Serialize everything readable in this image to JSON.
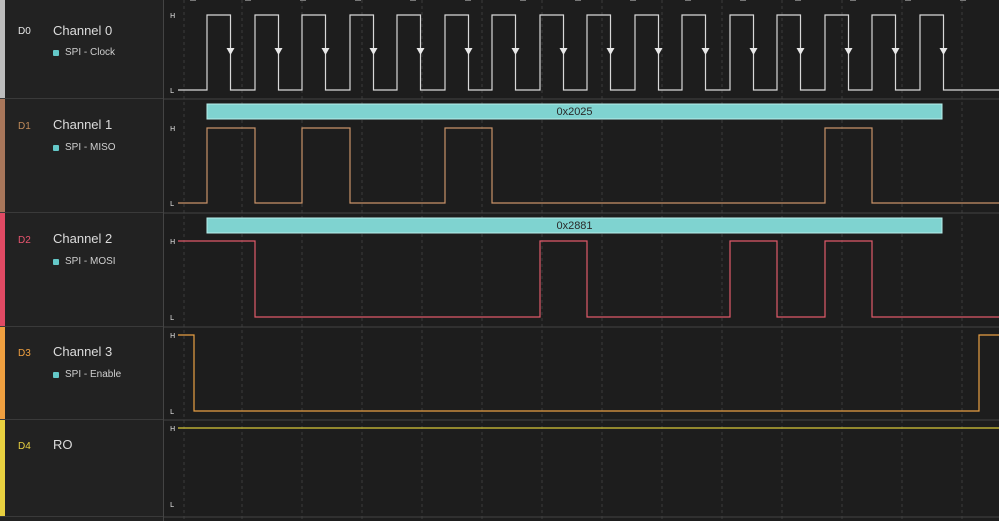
{
  "channels": [
    {
      "id": "D0",
      "name": "Channel 0",
      "analyzer": "SPI - Clock",
      "color": "#e8e8e8",
      "bar": "#bdbdbd",
      "wave": "#d8d8d8",
      "levels": [
        "H",
        "L"
      ]
    },
    {
      "id": "D1",
      "name": "Channel 1",
      "analyzer": "SPI - MISO",
      "color": "#c08a5a",
      "bar": "#a8765a",
      "wave": "#c89268",
      "levels": [
        "H",
        "L"
      ],
      "packet": "0x2025"
    },
    {
      "id": "D2",
      "name": "Channel 2",
      "analyzer": "SPI - MOSI",
      "color": "#e8546e",
      "bar": "#e04a64",
      "wave": "#e05a6a",
      "levels": [
        "H",
        "L"
      ],
      "packet": "0x2881"
    },
    {
      "id": "D3",
      "name": "Channel 3",
      "analyzer": "SPI - Enable",
      "color": "#f0a040",
      "bar": "#f0a040",
      "wave": "#e8a044",
      "levels": [
        "H",
        "L"
      ]
    },
    {
      "id": "D4",
      "name": "RO",
      "analyzer": "",
      "color": "#e8d040",
      "bar": "#e8d040",
      "wave": "#d8c838",
      "levels": [
        "H",
        "L"
      ]
    }
  ],
  "packet_color": "#7fd3d0"
}
